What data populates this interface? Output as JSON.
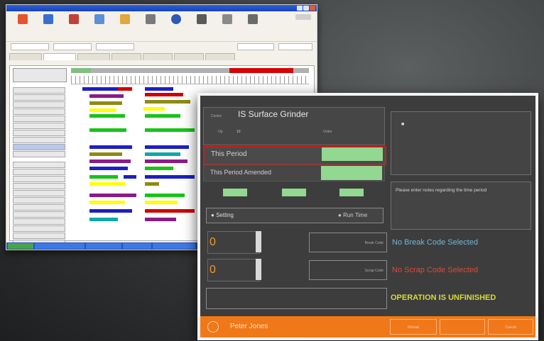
{
  "back_window": {
    "title": "",
    "toolbar": {
      "icons": [
        "exit-icon",
        "calendar-icon",
        "chart-icon",
        "wrench-icon",
        "gear-icon",
        "scissors-icon",
        "info-icon",
        "user-icon",
        "document-icon",
        "logo-icon"
      ]
    },
    "topbar_colors": {
      "gray": "#b0b0b0",
      "red": "#d80000",
      "green": "#7fbf7f"
    },
    "gantt_colors": [
      "#1c1fc4",
      "#8b1a89",
      "#d10000",
      "#8f8b12",
      "#ffff00",
      "#17c417",
      "#0fa8a8",
      "#ffffff"
    ]
  },
  "terminal": {
    "window_title": "",
    "machine": {
      "label": "Centre",
      "name": "IS Surface Grinder",
      "op_label": "Op",
      "op_value": "10",
      "order_label": "Order",
      "order_value": ""
    },
    "this_period": {
      "label": "This Period",
      "value": ""
    },
    "this_period_amended": {
      "label": "This Period Amended",
      "value": ""
    },
    "mode": {
      "setting": "Setting",
      "run_time": "Run Time"
    },
    "operators_title": "",
    "operator_entry": {
      "name": "",
      "time": ""
    },
    "notes_title": "",
    "notes_placeholder": "Please enter notes regarding the time period",
    "good_label": "",
    "good_value": "0",
    "scrap_label": "",
    "scrap_value": "0",
    "break_code_button": "Break Code",
    "scrap_code_button": "Scrap Code",
    "finish_button": "",
    "no_break": "No Break Code Selected",
    "no_scrap": "No Scrap Code Selected",
    "status": "OPERATION IS UNFINISHED",
    "user": "Peter Jones",
    "bottom_buttons": [
      "Reload",
      "",
      "Cancel"
    ],
    "colors": {
      "accent_orange": "#f07818",
      "green": "#92d890",
      "cyan_text": "#6fb6d3",
      "red_text": "#e0473b",
      "yellow_text": "#d8dc36",
      "highlight_red": "#c81e1e"
    }
  }
}
